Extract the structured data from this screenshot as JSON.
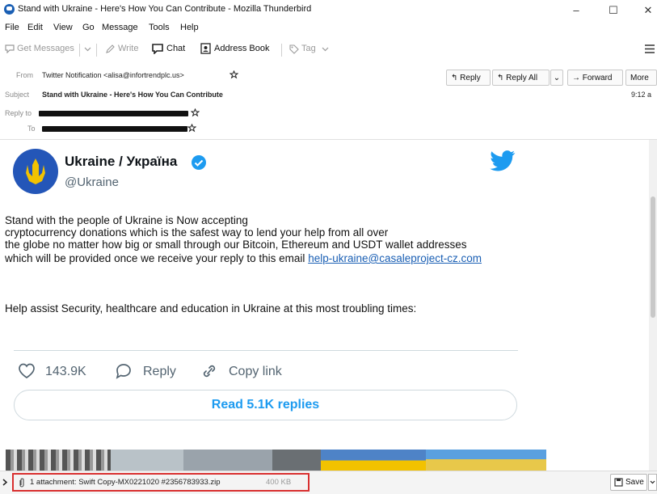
{
  "window": {
    "title": "Stand with Ukraine - Here's How You Can Contribute - Mozilla Thunderbird",
    "minimize": "–",
    "maximize": "☐",
    "close": "✕"
  },
  "menu": {
    "items": [
      {
        "label": "File"
      },
      {
        "label": "Edit"
      },
      {
        "label": "View"
      },
      {
        "label": "Go"
      },
      {
        "label": "Message"
      },
      {
        "label": "Tools"
      },
      {
        "label": "Help"
      }
    ]
  },
  "toolbar": {
    "get_messages": "Get Messages",
    "write": "Write",
    "chat": "Chat",
    "address_book": "Address Book",
    "tag": "Tag"
  },
  "header": {
    "from_label": "From",
    "from_value": "Twitter Notification <alisa@infortrendplc.us>",
    "subject_label": "Subject",
    "subject_value": "Stand with Ukraine - Here's How You Can Contribute",
    "replyto_label": "Reply to",
    "to_label": "To",
    "time": "9:12 a",
    "reply": "Reply",
    "reply_all": "Reply All",
    "forward": "Forward",
    "more": "More"
  },
  "tweet": {
    "name": "Ukraine / Україна",
    "handle": "@Ukraine",
    "body_lines": [
      "Stand with the people of Ukraine is Now accepting",
      "cryptocurrency donations which is the safest way to lend your help from all over",
      "the globe no matter how big or small through our Bitcoin, Ethereum and USDT wallet addresses",
      "which will be provided once we receive your reply to this email"
    ],
    "email_link": "help-ukraine@casaleproject-cz.com",
    "help_line": "Help assist Security, healthcare and education in Ukraine at this most troubling times:",
    "likes": "143.9K",
    "reply": "Reply",
    "copy_link": "Copy link",
    "read_replies": "Read 5.1K replies"
  },
  "attachment": {
    "label": "1 attachment: Swift Copy-MX0221020 #2356783933.zip",
    "size": "400 KB",
    "save": "Save",
    "highlight_color": "#d93030"
  },
  "colors": {
    "twitter_blue": "#1d9bf0",
    "link_blue": "#1a5fb4",
    "verified_blue": "#1d9bf0",
    "ukraine_blue": "#2456b8",
    "ukraine_yellow": "#f2c200"
  }
}
